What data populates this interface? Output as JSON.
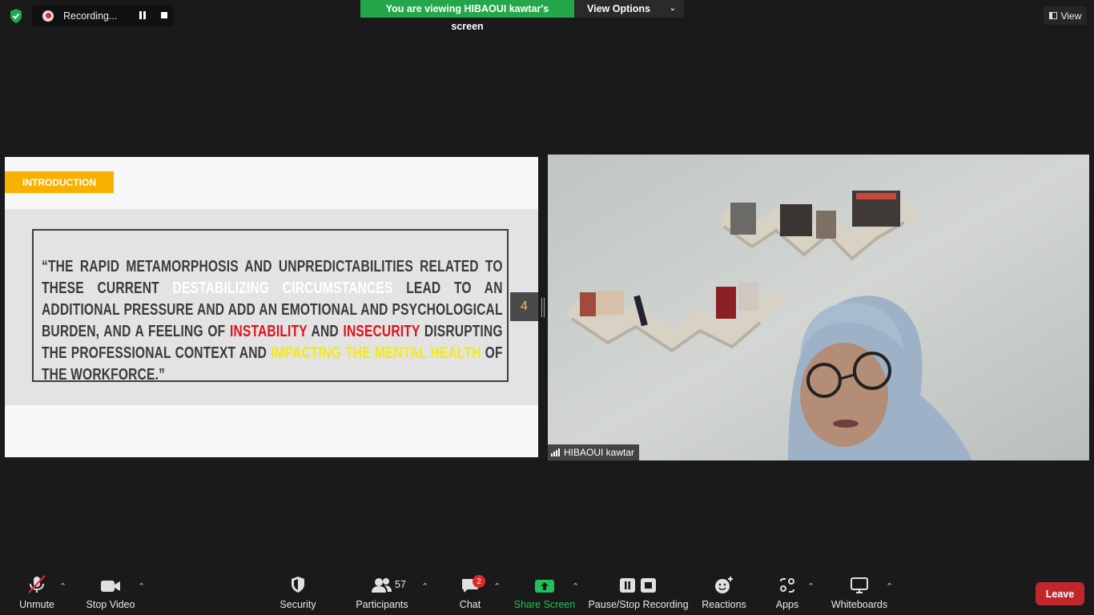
{
  "recording": {
    "label": "Recording..."
  },
  "banner": {
    "viewing_text": "You are viewing HIBAOUI kawtar's screen",
    "view_options_label": "View Options"
  },
  "view_button": {
    "label": "View"
  },
  "slide": {
    "section_tag": "INTRODUCTION",
    "quote_parts": [
      {
        "text": "“The rapid metamorphosis and unpredictabilities related to these current ",
        "style": "normal"
      },
      {
        "text": "destabilizing circumstances",
        "style": "white"
      },
      {
        "text": " lead to an additional pressure and add an emotional and psychological burden, and a feeling of ",
        "style": "normal"
      },
      {
        "text": "instability",
        "style": "red"
      },
      {
        "text": " and ",
        "style": "normal"
      },
      {
        "text": "insecurity",
        "style": "red"
      },
      {
        "text": " disrupting the professional context and ",
        "style": "normal"
      },
      {
        "text": "impacting the mental health",
        "style": "yellow"
      },
      {
        "text": " of the workforce.”",
        "style": "normal"
      }
    ],
    "page_number": "4",
    "colors": {
      "tag": "#f8b100",
      "red_highlight": "#e0141b",
      "yellow_highlight": "#f4ea16"
    }
  },
  "video": {
    "participant_name": "HIBAOUI kawtar"
  },
  "toolbar": {
    "unmute": "Unmute",
    "stop_video": "Stop Video",
    "security": "Security",
    "participants": "Participants",
    "participants_count": "57",
    "chat": "Chat",
    "chat_badge": "2",
    "share_screen": "Share Screen",
    "pause_stop_recording": "Pause/Stop Recording",
    "reactions": "Reactions",
    "apps": "Apps",
    "whiteboards": "Whiteboards",
    "leave": "Leave"
  }
}
